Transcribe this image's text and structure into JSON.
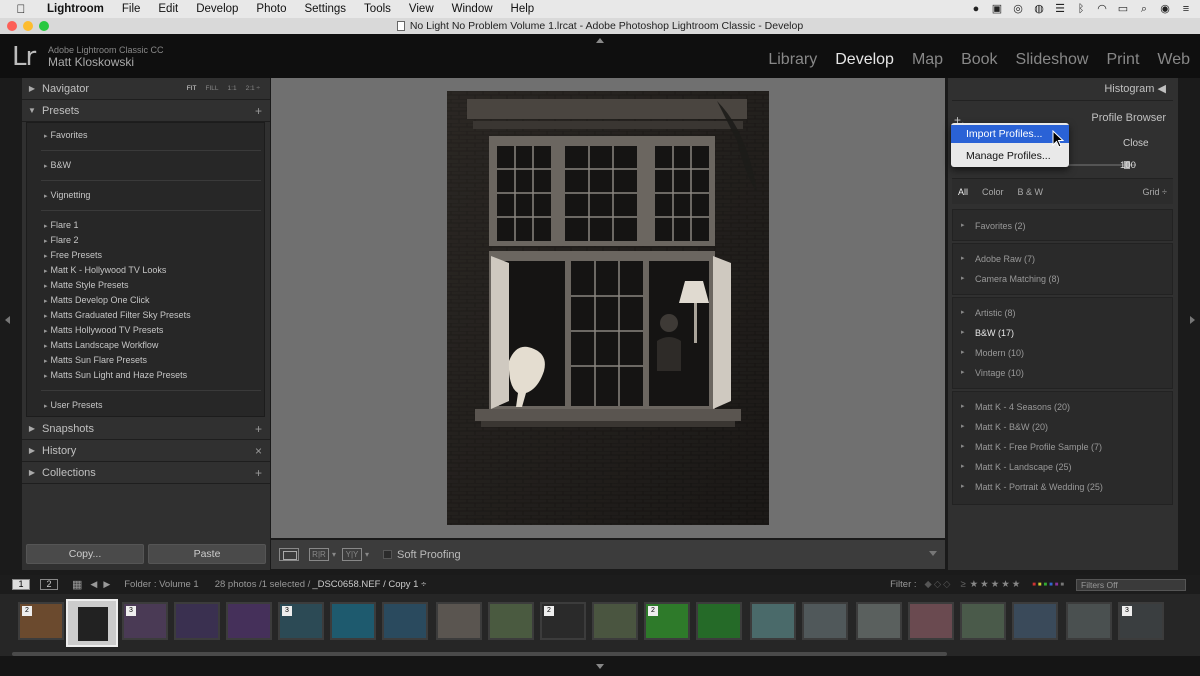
{
  "menubar": {
    "items": [
      "Lightroom",
      "File",
      "Edit",
      "Develop",
      "Photo",
      "Settings",
      "Tools",
      "View",
      "Window",
      "Help"
    ]
  },
  "window": {
    "title": "No Light No Problem Volume 1.lrcat - Adobe Photoshop Lightroom Classic - Develop"
  },
  "identity": {
    "logo": "Lr",
    "product": "Adobe Lightroom Classic CC",
    "user": "Matt Kloskowski"
  },
  "modules": [
    "Library",
    "Develop",
    "Map",
    "Book",
    "Slideshow",
    "Print",
    "Web"
  ],
  "active_module": "Develop",
  "left_panel": {
    "navigator": {
      "title": "Navigator",
      "zoom_options": [
        "FIT",
        "FILL",
        "1:1",
        "2:1 ÷"
      ]
    },
    "presets": {
      "title": "Presets",
      "items": [
        "Favorites",
        "B&W",
        "Vignetting",
        "Flare 1",
        "Flare 2",
        "Free Presets",
        "Matt K - Hollywood TV Looks",
        "Matte Style Presets",
        "Matts Develop One Click",
        "Matts Graduated Filter Sky Presets",
        "Matts Hollywood TV Presets",
        "Matts Landscape Workflow",
        "Matts Sun Flare Presets",
        "Matts Sun Light and Haze Presets",
        "User Presets"
      ]
    },
    "snapshots": "Snapshots",
    "history": "History",
    "collections": "Collections",
    "copy_button": "Copy...",
    "paste_button": "Paste"
  },
  "toolbar": {
    "soft_proofing": "Soft Proofing",
    "compare1": "R|R",
    "compare2": "Y|Y"
  },
  "right_panel": {
    "histogram": "Histogram",
    "profile_browser": "Profile Browser",
    "close": "Close",
    "amount": "100",
    "filters": [
      "All",
      "Color",
      "B & W"
    ],
    "grid": "Grid ÷",
    "groups": [
      [
        "Favorites (2)"
      ],
      [
        "Adobe Raw (7)",
        "Camera Matching (8)"
      ],
      [
        "Artistic (8)",
        "B&W (17)",
        "Modern (10)",
        "Vintage (10)"
      ],
      [
        "Matt K - 4 Seasons (20)",
        "Matt K - B&W (20)",
        "Matt K - Free Profile Sample (7)",
        "Matt K - Landscape (25)",
        "Matt K - Portrait & Wedding (25)"
      ]
    ],
    "active_item": "B&W (17)"
  },
  "dropdown": {
    "items": [
      "Import Profiles...",
      "Manage Profiles..."
    ],
    "selected": "Import Profiles..."
  },
  "filmstrip_bar": {
    "page1": "1",
    "page2": "2",
    "folder": "Folder : Volume 1",
    "count": "28 photos /1 selected /",
    "filename": "_DSC0658.NEF / Copy 1 ÷",
    "filter_label": "Filter :",
    "filters_off": "Filters Off"
  },
  "filmstrip": {
    "badges": [
      "2",
      "3",
      "3",
      "2",
      "2",
      "3"
    ]
  },
  "colors": {
    "accent": "#2a62d6",
    "panel": "#303030",
    "center": "#707070"
  }
}
